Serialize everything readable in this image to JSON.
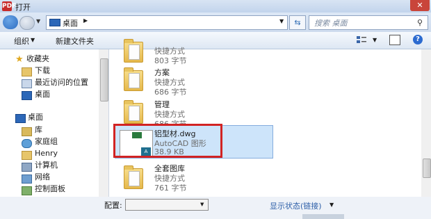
{
  "window": {
    "title": "打开",
    "app_icon": "PDF",
    "close_glyph": "✕"
  },
  "address": {
    "path": "桌面",
    "search_placeholder": "搜索 桌面",
    "refresh_glyph": "⇆"
  },
  "toolbar": {
    "organize": "组织",
    "new_folder": "新建文件夹"
  },
  "sidebar": {
    "favorites_header": "收藏夹",
    "favorites": [
      "下载",
      "最近访问的位置",
      "桌面"
    ],
    "desktop_header": "桌面",
    "desktop_items": [
      "库",
      "家庭组",
      "Henry",
      "计算机",
      "网络",
      "控制面板"
    ]
  },
  "files": [
    {
      "name": "",
      "type": "快捷方式",
      "size": "803 字节"
    },
    {
      "name": "方案",
      "type": "快捷方式",
      "size": "686 字节"
    },
    {
      "name": "管理",
      "type": "快捷方式",
      "size": "686 字节"
    },
    {
      "name": "铝型材.dwg",
      "type": "AutoCAD 图形",
      "size": "38.9 KB",
      "selected": true
    },
    {
      "name": "全套图库",
      "type": "快捷方式",
      "size": "761 字节"
    }
  ],
  "bottom": {
    "config_label": "配置:",
    "status": "显示状态(链接)"
  },
  "colors": {
    "accent": "#2c6bd0",
    "highlight": "#d22323",
    "selection": "#cde4fa"
  }
}
